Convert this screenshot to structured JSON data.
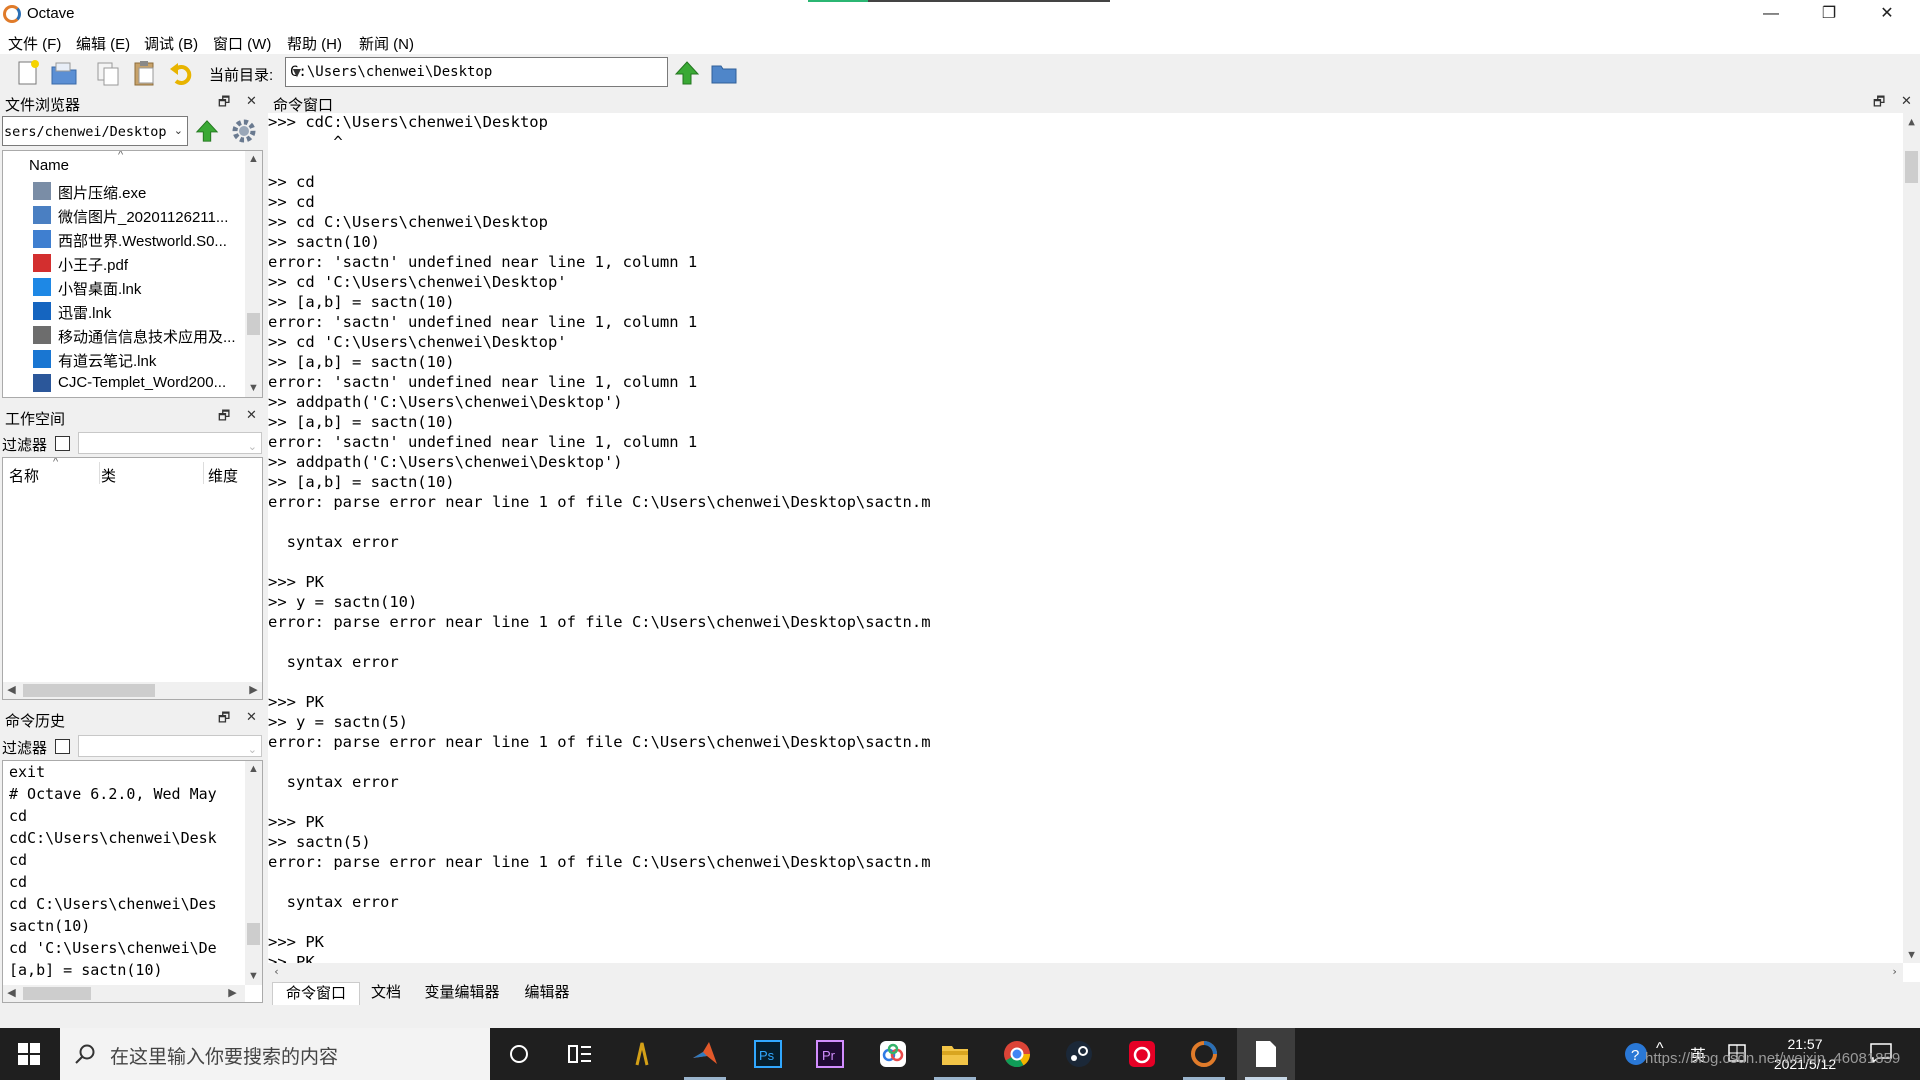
{
  "window": {
    "title": "Octave",
    "minimize": "—",
    "restore": "❐",
    "close": "✕"
  },
  "menu": [
    "文件 (F)",
    "编辑 (E)",
    "调试 (B)",
    "窗口 (W)",
    "帮助 (H)",
    "新闻 (N)"
  ],
  "toolbar": {
    "curdir_label": "当前目录:",
    "curdir_value": "C:\\Users\\chenwei\\Desktop"
  },
  "file_browser": {
    "title": "文件浏览器",
    "path": "sers/chenwei/Desktop",
    "column": "Name",
    "files": [
      {
        "name": "图片压缩.exe",
        "icon": "exe-icon"
      },
      {
        "name": "微信图片_20201126211...",
        "icon": "image-icon"
      },
      {
        "name": "西部世界.Westworld.S0...",
        "icon": "video-icon"
      },
      {
        "name": "小王子.pdf",
        "icon": "pdf-icon"
      },
      {
        "name": "小智桌面.lnk",
        "icon": "shortcut-icon"
      },
      {
        "name": "迅雷.lnk",
        "icon": "thunder-icon"
      },
      {
        "name": "移动通信信息技术应用及...",
        "icon": "archive-icon"
      },
      {
        "name": "有道云笔记.lnk",
        "icon": "note-icon"
      },
      {
        "name": "CJC-Templet_Word200...",
        "icon": "word-icon"
      }
    ]
  },
  "workspace": {
    "title": "工作空间",
    "filter_label": "过滤器",
    "columns": [
      "名称",
      "类",
      "维度"
    ]
  },
  "history": {
    "title": "命令历史",
    "filter_label": "过滤器",
    "items": [
      "exit",
      "# Octave 6.2.0, Wed May",
      "cd",
      "cdC:\\Users\\chenwei\\Desk",
      "cd",
      "cd",
      "cd C:\\Users\\chenwei\\Des",
      "sactn(10)",
      "cd 'C:\\Users\\chenwei\\De",
      "[a,b] = sactn(10)"
    ]
  },
  "command_window": {
    "title": "命令窗口",
    "lines": [
      ">>> cdC:\\Users\\chenwei\\Desktop",
      "       ^",
      "",
      ">> cd",
      ">> cd",
      ">> cd C:\\Users\\chenwei\\Desktop",
      ">> sactn(10)",
      "error: 'sactn' undefined near line 1, column 1",
      ">> cd 'C:\\Users\\chenwei\\Desktop'",
      ">> [a,b] = sactn(10)",
      "error: 'sactn' undefined near line 1, column 1",
      ">> cd 'C:\\Users\\chenwei\\Desktop'",
      ">> [a,b] = sactn(10)",
      "error: 'sactn' undefined near line 1, column 1",
      ">> addpath('C:\\Users\\chenwei\\Desktop')",
      ">> [a,b] = sactn(10)",
      "error: 'sactn' undefined near line 1, column 1",
      ">> addpath('C:\\Users\\chenwei\\Desktop')",
      ">> [a,b] = sactn(10)",
      "error: parse error near line 1 of file C:\\Users\\chenwei\\Desktop\\sactn.m",
      "",
      "  syntax error",
      "",
      ">>> PK",
      ">> y = sactn(10)",
      "error: parse error near line 1 of file C:\\Users\\chenwei\\Desktop\\sactn.m",
      "",
      "  syntax error",
      "",
      ">>> PK",
      ">> y = sactn(5)",
      "error: parse error near line 1 of file C:\\Users\\chenwei\\Desktop\\sactn.m",
      "",
      "  syntax error",
      "",
      ">>> PK",
      ">> sactn(5)",
      "error: parse error near line 1 of file C:\\Users\\chenwei\\Desktop\\sactn.m",
      "",
      "  syntax error",
      "",
      ">>> PK",
      ">> PK"
    ]
  },
  "tabs": [
    "命令窗口",
    "文档",
    "变量编辑器",
    "编辑器"
  ],
  "taskbar": {
    "search_placeholder": "在这里输入你要搜索的内容",
    "time": "21:57",
    "date": "2021/5/12",
    "ime": "英",
    "watermark": "https://blog.csdn.net/weixin_46081859"
  }
}
